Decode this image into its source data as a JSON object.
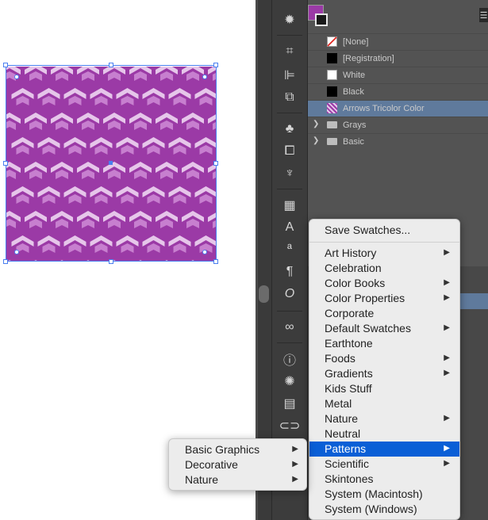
{
  "swatches": {
    "items": [
      {
        "label": "[None]",
        "kind": "none",
        "color": "#ffffff"
      },
      {
        "label": "[Registration]",
        "kind": "solid",
        "color": "#000000"
      },
      {
        "label": "White",
        "kind": "solid",
        "color": "#ffffff"
      },
      {
        "label": "Black",
        "kind": "solid",
        "color": "#000000"
      },
      {
        "label": "Arrows Tricolor Color",
        "kind": "pattern",
        "color": "#9b3aa6",
        "selected": true
      }
    ],
    "folders": [
      {
        "label": "Grays"
      },
      {
        "label": "Basic"
      }
    ]
  },
  "menu": {
    "save_label": "Save Swatches...",
    "items": [
      {
        "label": "Art History",
        "submenu": true
      },
      {
        "label": "Celebration",
        "submenu": false
      },
      {
        "label": "Color Books",
        "submenu": true
      },
      {
        "label": "Color Properties",
        "submenu": true
      },
      {
        "label": "Corporate",
        "submenu": false
      },
      {
        "label": "Default Swatches",
        "submenu": true
      },
      {
        "label": "Earthtone",
        "submenu": false
      },
      {
        "label": "Foods",
        "submenu": true
      },
      {
        "label": "Gradients",
        "submenu": true
      },
      {
        "label": "Kids Stuff",
        "submenu": false
      },
      {
        "label": "Metal",
        "submenu": false
      },
      {
        "label": "Nature",
        "submenu": true
      },
      {
        "label": "Neutral",
        "submenu": false
      },
      {
        "label": "Patterns",
        "submenu": true,
        "highlighted": true
      },
      {
        "label": "Scientific",
        "submenu": true
      },
      {
        "label": "Skintones",
        "submenu": false
      },
      {
        "label": "System (Macintosh)",
        "submenu": false
      },
      {
        "label": "System (Windows)",
        "submenu": false
      }
    ]
  },
  "submenu": {
    "items": [
      {
        "label": "Basic Graphics"
      },
      {
        "label": "Decorative"
      },
      {
        "label": "Nature"
      }
    ]
  },
  "toolbar": {
    "icons": [
      "sun-icon",
      "crop-icon",
      "align-icon",
      "pathfinder-icon",
      "symbols-icon",
      "transform-icon",
      "brush-icon",
      "layers-icon",
      "character-icon",
      "paragraph-style-icon",
      "paragraph-icon",
      "opentype-icon",
      "creative-cloud-icon",
      "info-icon",
      "navigator-icon",
      "document-info-icon",
      "links-icon"
    ]
  },
  "colors": {
    "accent": "#0a5fd6",
    "pattern_dark": "#9b3aa6",
    "pattern_mid": "#c77fcf",
    "pattern_light": "#e6c6ea",
    "selection": "#4a7ff0"
  }
}
